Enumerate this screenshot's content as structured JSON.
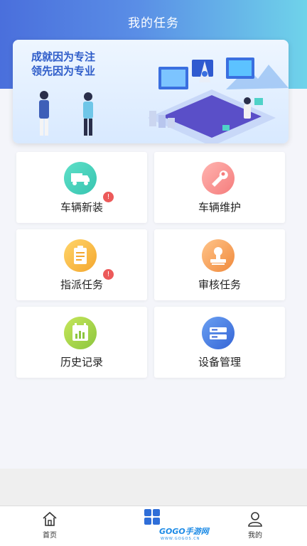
{
  "header": {
    "title": "我的任务"
  },
  "banner": {
    "slogan_line1": "成就因为专注",
    "slogan_line2": "领先因为专业"
  },
  "cards": [
    {
      "label": "车辆新装",
      "icon": "truck-icon",
      "badge": "!",
      "color_from": "#5ee0c8",
      "color_to": "#37c4b0"
    },
    {
      "label": "车辆维护",
      "icon": "wrench-icon",
      "color_from": "#ffb4b0",
      "color_to": "#f57c7c"
    },
    {
      "label": "指派任务",
      "icon": "clipboard-icon",
      "badge": "!",
      "color_from": "#ffd56b",
      "color_to": "#f4a72e"
    },
    {
      "label": "审核任务",
      "icon": "stamp-icon",
      "color_from": "#ffc48a",
      "color_to": "#f08a3c"
    },
    {
      "label": "历史记录",
      "icon": "calendar-chart-icon",
      "color_from": "#c6e65a",
      "color_to": "#8cc63f"
    },
    {
      "label": "设备管理",
      "icon": "server-icon",
      "color_from": "#6aa0f2",
      "color_to": "#3565d6"
    }
  ],
  "tabbar": {
    "home": "首页",
    "mine": "我的"
  },
  "watermark": {
    "text": "GOGO手游网",
    "sub": "WWW.GOGOS.CN"
  }
}
